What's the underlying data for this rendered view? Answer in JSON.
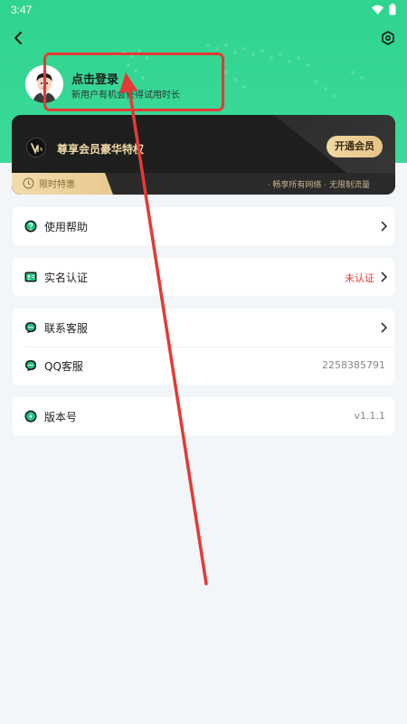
{
  "status": {
    "time": "3:47",
    "wifi_icon": "wifi-icon",
    "battery_icon": "battery-icon"
  },
  "header": {
    "back_icon": "back-arrow-icon",
    "settings_icon": "settings-hex-icon"
  },
  "profile": {
    "login_text": "点击登录",
    "subtitle": "新用户有机会获得试用时长"
  },
  "vip": {
    "title": "尊享会员豪华特权",
    "button": "开通会员",
    "tag": "限时特惠",
    "perks": "· 畅享所有网络 · 无限制流量"
  },
  "menu": {
    "help": {
      "label": "使用帮助"
    },
    "verify": {
      "label": "实名认证",
      "status": "未认证"
    },
    "contact": {
      "label": "联系客服"
    },
    "qq": {
      "label": "QQ客服",
      "value": "2258385791"
    },
    "version": {
      "label": "版本号",
      "value": "v1.1.1"
    }
  },
  "colors": {
    "header_green": "#2fd48e",
    "accent_red": "#e53935",
    "vip_gold": "#f0d9a6",
    "icon_green": "#1ec27e"
  }
}
